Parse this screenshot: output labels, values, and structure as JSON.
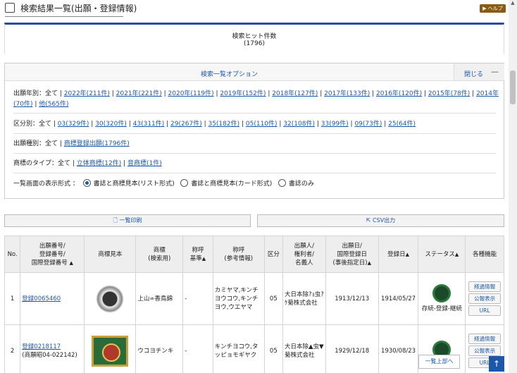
{
  "header": {
    "title": "検索結果一覧(出願・登録情報)",
    "help_label": "▶ ヘルプ"
  },
  "hit": {
    "label": "検索ヒット件数",
    "count": "(1796)"
  },
  "options": {
    "title": "検索一覧オプション",
    "close_label": "閉じる",
    "minimize_glyph": "—",
    "year_prefix": "出願年別：全て |",
    "years": [
      "2022年(211件)",
      "2021年(221件)",
      "2020年(119件)",
      "2019年(152件)",
      "2018年(127件)",
      "2017年(133件)",
      "2016年(120件)",
      "2015年(78件)",
      "2014年(70件)",
      "他(565件)"
    ],
    "class_prefix": "区分別：全て |",
    "classes": [
      "03(329件)",
      "30(320件)",
      "43(311件)",
      "29(267件)",
      "35(182件)",
      "05(110件)",
      "32(108件)",
      "33(99件)",
      "09(73件)",
      "25(64件)"
    ],
    "type_prefix": "出願種別：全て |",
    "types": [
      "商標登録出願(1796件)"
    ],
    "mark_prefix": "商標のタイプ：全て |",
    "marks": [
      "立体商標(12件)",
      "音商標(1件)"
    ],
    "display_label": "一覧画面の表示形式 ：",
    "display_options": [
      "書誌と商標見本(リスト形式)",
      "書誌と商標見本(カード形式)",
      "書誌のみ"
    ]
  },
  "buttons": {
    "print": "一覧印刷",
    "csv": "CSV出力"
  },
  "table": {
    "headers": [
      "No.",
      "出願番号/\n登録番号/\n国際登録番号",
      "商標見本",
      "商標\n(検索用)",
      "称呼\n基準",
      "称呼\n(参考情報)",
      "区分",
      "出願人/\n権利者/\n名義人",
      "出願日/\n国際登録日\n(事後指定日)",
      "登録日",
      "ステータス",
      "各種機能"
    ],
    "rows": [
      {
        "no": "1",
        "number": "登録0065460",
        "sub": "",
        "name": "上山∞香鳥錦",
        "kijun": "-",
        "yomi": "カミヤマ,キンチヨウコウ,キンチヨウ,ウエヤマ",
        "cls": "05",
        "owner": "大日本除?ｮ虫?ｹ菊株式会社",
        "app_date": "1913/12/13",
        "reg_date": "1914/05/27",
        "status": "存続-登録-継続"
      },
      {
        "no": "2",
        "number": "登録0218117",
        "sub": "(商願昭04-022142)",
        "name": "ウコヨチンキ",
        "kijun": "-",
        "yomi": "キンチヨコウ,タッピョモギヤク",
        "cls": "05",
        "owner": "大日本除▲虫▼菊株式会社",
        "app_date": "1929/12/18",
        "reg_date": "1930/08/23",
        "status": ""
      }
    ],
    "func_buttons": [
      "経過情報",
      "公報表示",
      "URL"
    ]
  },
  "nav": {
    "to_top": "一覧上部へ",
    "to_top_arrow": "↑"
  }
}
